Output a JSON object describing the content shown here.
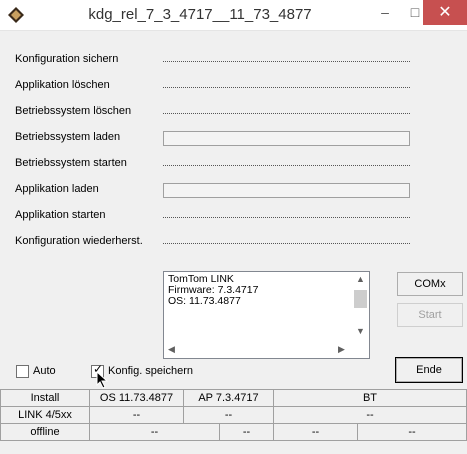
{
  "window": {
    "title": "kdg_rel_7_3_4717__11_73_4877",
    "app_icon": "diamond-app-icon",
    "minimize": "–",
    "maximize": "□",
    "close": "✕"
  },
  "steps": [
    {
      "label": "Konfiguration sichern",
      "indicator": "dots"
    },
    {
      "label": "Applikation löschen",
      "indicator": "dots"
    },
    {
      "label": "Betriebssystem löschen",
      "indicator": "dots"
    },
    {
      "label": "Betriebssystem laden",
      "indicator": "progress"
    },
    {
      "label": "Betriebssystem starten",
      "indicator": "dots"
    },
    {
      "label": "Applikation laden",
      "indicator": "progress"
    },
    {
      "label": "Applikation starten",
      "indicator": "dots"
    },
    {
      "label": "Konfiguration wiederherst.",
      "indicator": "dots"
    }
  ],
  "info": {
    "lines": "TomTom LINK\nFirmware: 7.3.4717\nOS: 11.73.4877"
  },
  "buttons": {
    "com": "COMx",
    "start": "Start",
    "ende": "Ende"
  },
  "options": {
    "auto_label": "Auto",
    "auto_checked": false,
    "konfig_label": "Konfig. speichern",
    "konfig_checked": true
  },
  "status": {
    "row1": [
      "Install",
      "OS 11.73.4877",
      "AP 7.3.4717",
      "BT"
    ],
    "row2": [
      "LINK 4/5xx",
      "--",
      "--",
      "--"
    ],
    "row3": [
      "offline",
      "--",
      "--",
      "--",
      "--"
    ]
  }
}
